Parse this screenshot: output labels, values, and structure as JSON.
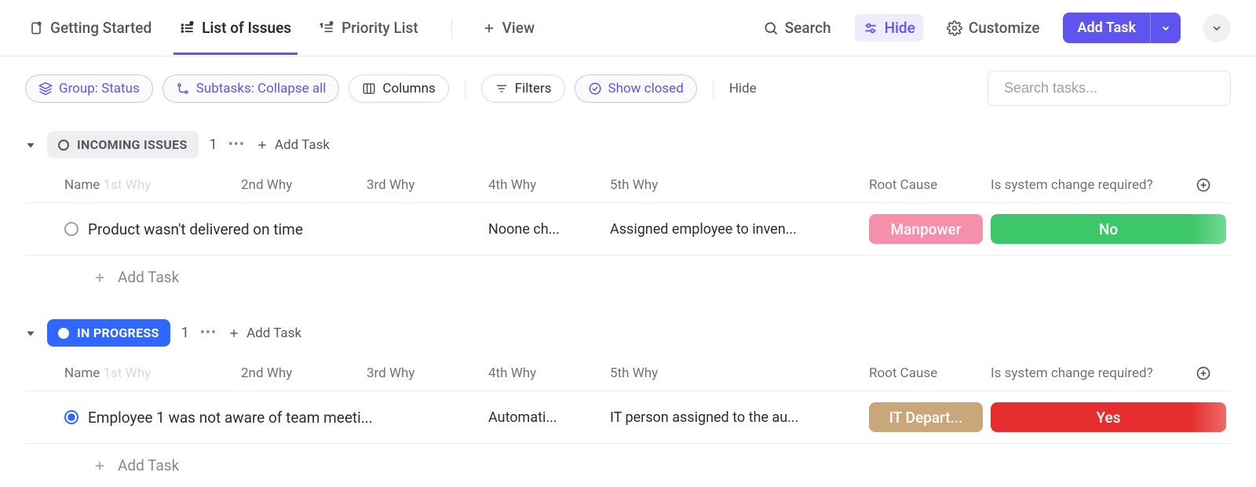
{
  "toolbar": {
    "tabs": [
      {
        "label": "Getting Started"
      },
      {
        "label": "List of Issues"
      },
      {
        "label": "Priority List"
      }
    ],
    "view_label": "View",
    "search_label": "Search",
    "hide_label": "Hide",
    "customize_label": "Customize",
    "add_task_label": "Add Task"
  },
  "filters": {
    "group_label": "Group: Status",
    "subtasks_label": "Subtasks: Collapse all",
    "columns_label": "Columns",
    "filters_label": "Filters",
    "show_closed_label": "Show closed",
    "hide_label": "Hide",
    "search_placeholder": "Search tasks..."
  },
  "columns": {
    "name": "Name",
    "first_why": "1st Why",
    "second_why": "2nd Why",
    "third_why": "3rd Why",
    "fourth_why": "4th Why",
    "fifth_why": "5th Why",
    "root_cause": "Root Cause",
    "system_change": "Is system change required?"
  },
  "groups": [
    {
      "status_label": "Incoming Issues",
      "count": "1",
      "add_task_label": "Add Task",
      "rows": [
        {
          "name": "Product wasn't delivered on time",
          "fourth_why": "Noone ch...",
          "fifth_why": "Assigned employee to inven...",
          "root_cause": "Manpower",
          "system_change": "No"
        }
      ],
      "add_row_label": "Add Task"
    },
    {
      "status_label": "In Progress",
      "count": "1",
      "add_task_label": "Add Task",
      "rows": [
        {
          "name": "Employee 1 was not aware of team meeti...",
          "fourth_why": "Automati...",
          "fifth_why": "IT person assigned to the au...",
          "root_cause": "IT Depart...",
          "system_change": "Yes"
        }
      ],
      "add_row_label": "Add Task"
    }
  ],
  "colors": {
    "primary": "#5f55ee",
    "blue": "#3068ff",
    "pink": "#f58fab",
    "green": "#3cc76a",
    "tan": "#c9a77a",
    "red": "#e62e2e"
  }
}
